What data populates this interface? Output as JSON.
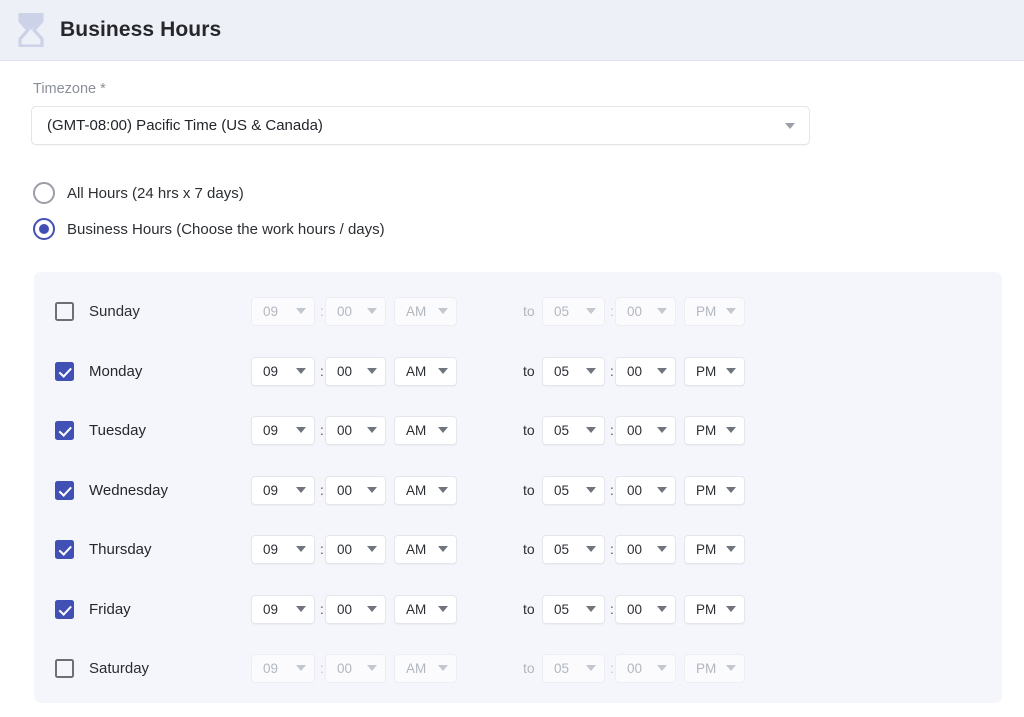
{
  "header": {
    "icon": "hourglass-icon",
    "title": "Business Hours"
  },
  "timezone": {
    "label": "Timezone *",
    "value": "(GMT-08:00) Pacific Time (US & Canada)",
    "dropdown_icon": "chevron-down-icon"
  },
  "mode": {
    "options": [
      {
        "label": "All Hours (24 hrs x 7 days)",
        "selected": false
      },
      {
        "label": "Business Hours (Choose the work hours / days)",
        "selected": true
      }
    ]
  },
  "schedule": {
    "separator": ":",
    "to_label": "to",
    "rows": [
      {
        "day": "Sunday",
        "checked": false,
        "start": {
          "hour": "09",
          "minute": "00",
          "meridiem": "AM"
        },
        "end": {
          "hour": "05",
          "minute": "00",
          "meridiem": "PM"
        }
      },
      {
        "day": "Monday",
        "checked": true,
        "start": {
          "hour": "09",
          "minute": "00",
          "meridiem": "AM"
        },
        "end": {
          "hour": "05",
          "minute": "00",
          "meridiem": "PM"
        }
      },
      {
        "day": "Tuesday",
        "checked": true,
        "start": {
          "hour": "09",
          "minute": "00",
          "meridiem": "AM"
        },
        "end": {
          "hour": "05",
          "minute": "00",
          "meridiem": "PM"
        }
      },
      {
        "day": "Wednesday",
        "checked": true,
        "start": {
          "hour": "09",
          "minute": "00",
          "meridiem": "AM"
        },
        "end": {
          "hour": "05",
          "minute": "00",
          "meridiem": "PM"
        }
      },
      {
        "day": "Thursday",
        "checked": true,
        "start": {
          "hour": "09",
          "minute": "00",
          "meridiem": "AM"
        },
        "end": {
          "hour": "05",
          "minute": "00",
          "meridiem": "PM"
        }
      },
      {
        "day": "Friday",
        "checked": true,
        "start": {
          "hour": "09",
          "minute": "00",
          "meridiem": "AM"
        },
        "end": {
          "hour": "05",
          "minute": "00",
          "meridiem": "PM"
        }
      },
      {
        "day": "Saturday",
        "checked": false,
        "start": {
          "hour": "09",
          "minute": "00",
          "meridiem": "AM"
        },
        "end": {
          "hour": "05",
          "minute": "00",
          "meridiem": "PM"
        }
      }
    ]
  },
  "colors": {
    "accent": "#4050b5",
    "header_bg": "#eef0f7",
    "panel_bg": "#f5f6fb",
    "icon": "#ccd2e8"
  }
}
